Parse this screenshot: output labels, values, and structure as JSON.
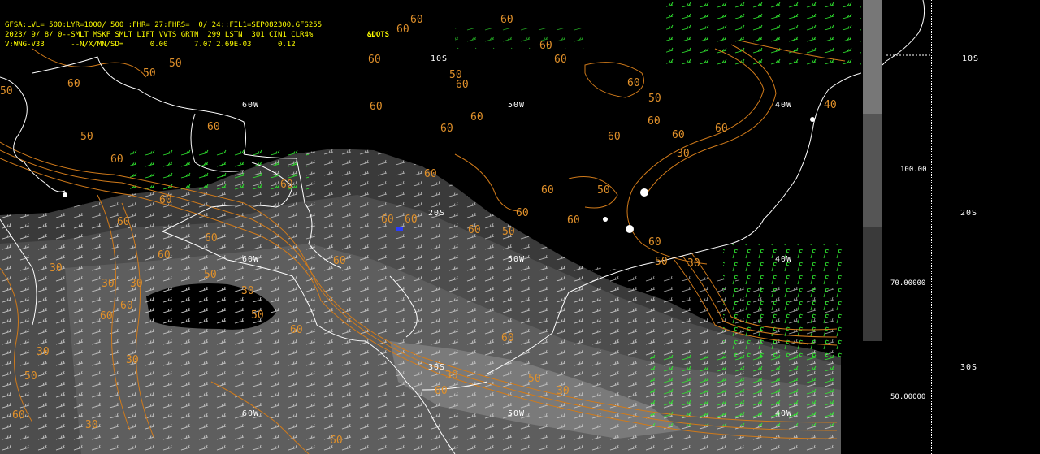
{
  "header": {
    "line1": "GFSA:LVL= 500:LYR=1000/ 500 :FHR= 27:FHRS=  0/ 24::FIL1=SEP082300.GFS255",
    "line2": "2023/ 9/ 8/ 0--SMLT MSKF SMLT LIFT VVTS GRTN  299 LSTN  301 CIN1 CLR4%",
    "line3": "V:WNG-V33      --N/X/MN/SD=      0.00      7.07 2.69E-03      0.12",
    "dots_label": "&DOTS"
  },
  "longitude_labels": [
    {
      "text": "60W"
    },
    {
      "text": "50W"
    },
    {
      "text": "40W"
    },
    {
      "text": "60W"
    },
    {
      "text": "50W"
    },
    {
      "text": "40W"
    },
    {
      "text": "60W"
    },
    {
      "text": "50W"
    },
    {
      "text": "40W"
    }
  ],
  "latitude_labels": [
    {
      "text": "10S"
    },
    {
      "text": "20S"
    },
    {
      "text": "30S"
    }
  ],
  "right_lat_labels": [
    "10S",
    "20S",
    "30S"
  ],
  "scale_labels": [
    "100.00",
    "70.00000",
    "50.00000"
  ],
  "contour_labels": {
    "values": [
      "60",
      "50",
      "40",
      "30"
    ]
  },
  "colors": {
    "contour": "#d07a1a",
    "contour_label": "#e0902a",
    "wind_green": "#2fe62f",
    "wind_white": "#c8c8c8",
    "coast": "#ffffff",
    "header": "#ffff00",
    "shade_dark": "#3a3a3a",
    "shade_mid": "#555555",
    "shade_light": "#777777"
  }
}
